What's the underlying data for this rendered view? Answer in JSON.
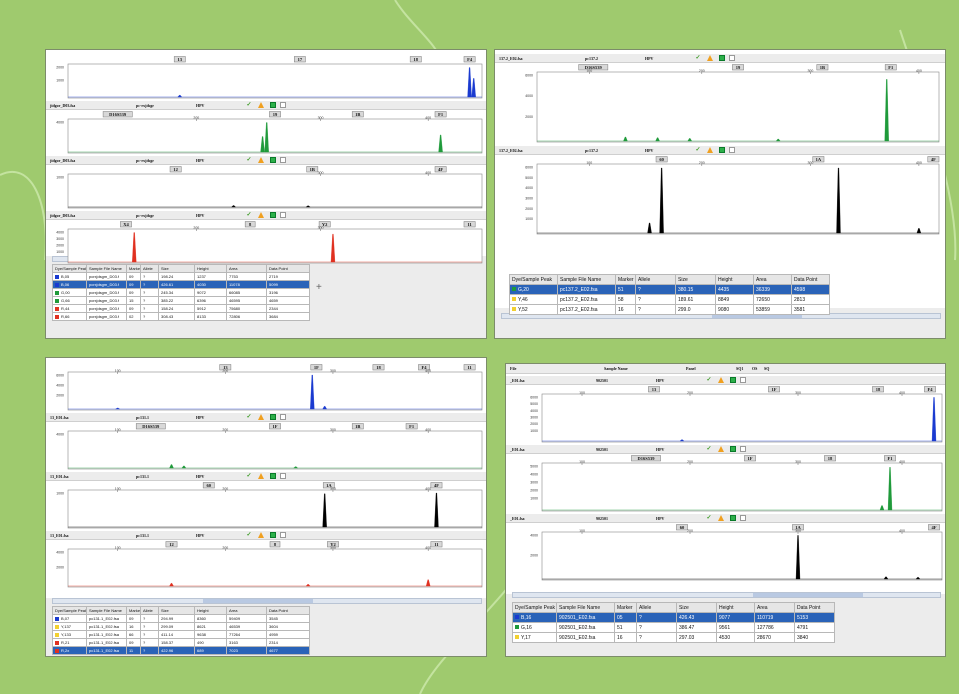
{
  "colors": {
    "background": "#9fca6e",
    "selected_row": "#2a63b8",
    "blue": "#1a3ad0",
    "green": "#1f9a3a",
    "black": "#000000",
    "red": "#e03020",
    "yellow": "#f2d030"
  },
  "panels": {
    "tl": {
      "tracks": [
        {
          "header": null,
          "bins": [
            [
              "13",
              0.27
            ],
            [
              "17",
              0.56
            ],
            [
              "18",
              0.84
            ],
            [
              "F4",
              0.97
            ]
          ],
          "ticks": [],
          "color": "#1a3ad0",
          "peaks": [
            [
              0.27,
              0.06
            ],
            [
              0.97,
              0.95
            ],
            [
              0.98,
              0.6
            ]
          ]
        },
        {
          "header": {
            "file": "jidgor_D03.fsa",
            "sample": "pc-rxjdsgr",
            "panel": "HPV"
          },
          "bins": [
            [
              "D16S539",
              0.12
            ],
            [
              "19",
              0.5
            ],
            [
              "1B",
              0.7
            ],
            [
              "F1",
              0.9
            ]
          ],
          "ticks": [
            [
              "200",
              0.31
            ],
            [
              "300",
              0.61
            ],
            [
              "400",
              0.87
            ]
          ],
          "color": "#1f9a3a",
          "peaks": [
            [
              0.48,
              0.95
            ],
            [
              0.47,
              0.5
            ],
            [
              0.9,
              0.55
            ]
          ]
        },
        {
          "header": {
            "file": "jidgor_D03.fsa",
            "sample": "pc-rxjdsgr",
            "panel": "HPV"
          },
          "bins": [
            [
              "12",
              0.26
            ],
            [
              "1B",
              0.59
            ],
            [
              "4F",
              0.9
            ]
          ],
          "ticks": [
            [
              "300",
              0.61
            ],
            [
              "400",
              0.87
            ]
          ],
          "color": "#000000",
          "peaks": [
            [
              0.4,
              0.05
            ],
            [
              0.58,
              0.04
            ]
          ]
        },
        {
          "header": {
            "file": "jidgor_D03.fsa",
            "sample": "pc-rxjdsgr",
            "panel": "HPV"
          },
          "bins": [
            [
              "X4",
              0.14
            ],
            [
              "8",
              0.44
            ],
            [
              "Y2",
              0.62
            ],
            [
              "11",
              0.97
            ]
          ],
          "ticks": [
            [
              "200",
              0.31
            ],
            [
              "300",
              0.61
            ]
          ],
          "color": "#e03020",
          "peaks": [
            [
              0.16,
              0.95
            ],
            [
              0.64,
              0.9
            ]
          ]
        }
      ],
      "yaxes": [
        [
          "2000",
          "1000"
        ],
        [
          "4000"
        ],
        [
          "1000"
        ],
        [
          "4000",
          "3000",
          "2000",
          "1000"
        ]
      ],
      "table": {
        "headers": [
          "Dye/Sample Peak",
          "Sample File Name",
          "Marker",
          "Allele",
          "Size",
          "Height",
          "Area",
          "Data Point"
        ],
        "rows": [
          {
            "dye": "#1a3ad0",
            "sel": false,
            "cells": [
              "B,05",
              "pcrxjdsgm_D03.f",
              "09",
              "?",
              "198.24",
              "1237",
              "7753",
              "2719"
            ]
          },
          {
            "dye": "#1a3ad0",
            "sel": true,
            "cells": [
              "B,06",
              "pcrxjdsgm_D03.f",
              "09",
              "?",
              "426.61",
              "4030",
              "11078",
              "5099"
            ]
          },
          {
            "dye": "#1f9a3a",
            "sel": false,
            "cells": [
              "G,00",
              "pcrxjdsgm_D03.f",
              "09",
              "?",
              "245.34",
              "9072",
              "66085",
              "3196"
            ]
          },
          {
            "dye": "#1f9a3a",
            "sel": false,
            "cells": [
              "G,66",
              "pcrxjdsgm_D03.f",
              "15",
              "?",
              "385.22",
              "6396",
              "46595",
              "4659"
            ]
          },
          {
            "dye": "#e03020",
            "sel": false,
            "cells": [
              "R,44",
              "pcrxjdsgm_D03.f",
              "09",
              "?",
              "158.24",
              "5912",
              "75680",
              "2344"
            ]
          },
          {
            "dye": "#e03020",
            "sel": false,
            "cells": [
              "R,66",
              "pcrxjdsgm_D03.f",
              "02",
              "?",
              "308.43",
              "8133",
              "72806",
              "3684"
            ]
          }
        ]
      }
    },
    "tr": {
      "tracks": [
        {
          "header": {
            "file": "137.2_E02.fsa",
            "sample": "pc137.2",
            "panel": "HPV"
          },
          "bins": [
            [
              "D16S539",
              0.14
            ],
            [
              "19",
              0.5
            ],
            [
              "1B",
              0.71
            ],
            [
              "F1",
              0.88
            ]
          ],
          "ticks": [
            [
              "100",
              0.13
            ],
            [
              "200",
              0.41
            ],
            [
              "300",
              0.68
            ],
            [
              "400",
              0.95
            ]
          ],
          "color": "#1f9a3a",
          "peaks": [
            [
              0.22,
              0.06
            ],
            [
              0.3,
              0.05
            ],
            [
              0.38,
              0.04
            ],
            [
              0.6,
              0.03
            ],
            [
              0.87,
              0.92
            ]
          ]
        },
        {
          "header": {
            "file": "137.2_E02.fsa",
            "sample": "pc137.2",
            "panel": "HPV"
          },
          "bins": [
            [
              "60",
              0.31
            ],
            [
              "1A",
              0.7
            ],
            [
              "4F",
              0.99
            ]
          ],
          "ticks": [
            [
              "100",
              0.13
            ],
            [
              "200",
              0.41
            ],
            [
              "300",
              0.68
            ],
            [
              "400",
              0.95
            ]
          ],
          "color": "#000000",
          "peaks": [
            [
              0.28,
              0.15
            ],
            [
              0.31,
              0.97
            ],
            [
              0.75,
              0.97
            ],
            [
              0.95,
              0.07
            ]
          ]
        }
      ],
      "yaxes": [
        [
          "6000",
          "4000",
          "2000"
        ],
        [
          "6000",
          "5000",
          "4000",
          "3000",
          "2000",
          "1000"
        ]
      ],
      "table": {
        "headers": [
          "Dye/Sample Peak",
          "Sample File Name",
          "Marker",
          "Allele",
          "Size",
          "Height",
          "Area",
          "Data Point"
        ],
        "rows": [
          {
            "dye": "#1f9a3a",
            "sel": true,
            "cells": [
              "G,20",
              "pc137.2_E02.fsa",
              "51",
              "?",
              "380.15",
              "4435",
              "36339",
              "4598"
            ]
          },
          {
            "dye": "#f2d030",
            "sel": false,
            "cells": [
              "Y,46",
              "pc137.2_E02.fsa",
              "58",
              "?",
              "189.61",
              "8849",
              "72650",
              "2813"
            ]
          },
          {
            "dye": "#f2d030",
            "sel": false,
            "cells": [
              "Y,52",
              "pc137.2_E02.fsa",
              "16",
              "?",
              "299.0",
              "9080",
              "53859",
              "3581"
            ]
          }
        ]
      }
    },
    "bl": {
      "tracks": [
        {
          "header": null,
          "bins": [
            [
              "13",
              0.38
            ],
            [
              "1F",
              0.6
            ],
            [
              "18",
              0.75
            ],
            [
              "F4",
              0.86
            ],
            [
              "11",
              0.97
            ]
          ],
          "ticks": [
            [
              "100",
              0.12
            ],
            [
              "200",
              0.38
            ],
            [
              "300",
              0.64
            ],
            [
              "400",
              0.87
            ]
          ],
          "color": "#1a3ad0",
          "peaks": [
            [
              0.12,
              0.03
            ],
            [
              0.59,
              0.97
            ],
            [
              0.62,
              0.08
            ]
          ]
        },
        {
          "header": {
            "file": "13_E01.fsa",
            "sample": "pc131.1",
            "panel": "HPV"
          },
          "bins": [
            [
              "D16S539",
              0.2
            ],
            [
              "1F",
              0.5
            ],
            [
              "1B",
              0.7
            ],
            [
              "F1",
              0.83
            ]
          ],
          "ticks": [
            [
              "100",
              0.12
            ],
            [
              "200",
              0.38
            ],
            [
              "300",
              0.64
            ],
            [
              "400",
              0.87
            ]
          ],
          "color": "#1f9a3a",
          "peaks": [
            [
              0.25,
              0.1
            ],
            [
              0.28,
              0.06
            ],
            [
              0.55,
              0.04
            ]
          ]
        },
        {
          "header": {
            "file": "13_E01.fsa",
            "sample": "pc131.1",
            "panel": "HPV"
          },
          "bins": [
            [
              "60",
              0.34
            ],
            [
              "1A",
              0.63
            ],
            [
              "4F",
              0.89
            ]
          ],
          "ticks": [
            [
              "100",
              0.12
            ],
            [
              "200",
              0.38
            ],
            [
              "300",
              0.64
            ],
            [
              "400",
              0.87
            ]
          ],
          "color": "#000000",
          "peaks": [
            [
              0.62,
              0.95
            ],
            [
              0.89,
              0.97
            ]
          ]
        },
        {
          "header": {
            "file": "13_E01.fsa",
            "sample": "pc131.1",
            "panel": "HPV"
          },
          "bins": [
            [
              "12",
              0.25
            ],
            [
              "8",
              0.5
            ],
            [
              "Y2",
              0.64
            ],
            [
              "11",
              0.89
            ]
          ],
          "ticks": [
            [
              "100",
              0.12
            ],
            [
              "200",
              0.38
            ],
            [
              "300",
              0.64
            ],
            [
              "400",
              0.87
            ]
          ],
          "color": "#e03020",
          "peaks": [
            [
              0.25,
              0.08
            ],
            [
              0.58,
              0.05
            ],
            [
              0.87,
              0.18
            ]
          ]
        }
      ],
      "yaxes": [
        [
          "6000",
          "4000",
          "2000"
        ],
        [
          "4000"
        ],
        [
          "1000"
        ],
        [
          "4000",
          "2000"
        ]
      ],
      "table": {
        "headers": [
          "Dye/Sample Peak",
          "Sample File Name",
          "Marker",
          "Allele",
          "Size",
          "Height",
          "Area",
          "Data Point"
        ],
        "rows": [
          {
            "dye": "#1a3ad0",
            "sel": false,
            "cells": [
              "B,07",
              "pc131.1_E02.fsa",
              "09",
              "?",
              "294.99",
              "8360",
              "59409",
              "3545"
            ]
          },
          {
            "dye": "#f2d030",
            "sel": false,
            "cells": [
              "Y,137",
              "pc131.1_E02.fsa",
              "16",
              "?",
              "299.09",
              "8621",
              "46539",
              "3604"
            ]
          },
          {
            "dye": "#f2d030",
            "sel": false,
            "cells": [
              "Y,133",
              "pc131.1_E02.fsa",
              "66",
              "?",
              "411.14",
              "9638",
              "77264",
              "4959"
            ]
          },
          {
            "dye": "#e03020",
            "sel": false,
            "cells": [
              "R,21",
              "pc131.1_E02.fsa",
              "09",
              "?",
              "158.37",
              "490",
              "3163",
              "2314"
            ]
          },
          {
            "dye": "#e03020",
            "sel": true,
            "cells": [
              "R,2x",
              "pc131.1_E02.fsa",
              "11",
              "?",
              "422.96",
              "689",
              "7023",
              "4677"
            ]
          }
        ]
      }
    },
    "br": {
      "top_header": {
        "file": "File",
        "sample": "Sample Name",
        "panel": "Panel",
        "sq1": "SQ1",
        "os": "OS",
        "sq": "SQ"
      },
      "tracks": [
        {
          "header": {
            "file": "_E01.fsa",
            "sample": "902501",
            "panel": "HPV"
          },
          "bins": [
            [
              "13",
              0.28
            ],
            [
              "1F",
              0.58
            ],
            [
              "18",
              0.84
            ],
            [
              "F4",
              0.97
            ]
          ],
          "ticks": [
            [
              "100",
              0.1
            ],
            [
              "200",
              0.37
            ],
            [
              "300",
              0.64
            ],
            [
              "400",
              0.9
            ]
          ],
          "color": "#1a3ad0",
          "peaks": [
            [
              0.98,
              0.97
            ],
            [
              0.35,
              0.03
            ]
          ]
        },
        {
          "header": {
            "file": "_E01.fsa",
            "sample": "902501",
            "panel": "HPV"
          },
          "bins": [
            [
              "D16S539",
              0.26
            ],
            [
              "1F",
              0.52
            ],
            [
              "18",
              0.72
            ],
            [
              "F1",
              0.87
            ]
          ],
          "ticks": [
            [
              "100",
              0.1
            ],
            [
              "200",
              0.37
            ],
            [
              "300",
              0.64
            ],
            [
              "400",
              0.9
            ]
          ],
          "color": "#1f9a3a",
          "peaks": [
            [
              0.87,
              0.95
            ],
            [
              0.85,
              0.1
            ]
          ]
        },
        {
          "header": {
            "file": "_E01.fsa",
            "sample": "902501",
            "panel": "HPV"
          },
          "bins": [
            [
              "60",
              0.35
            ],
            [
              "1A",
              0.64
            ],
            [
              "4F",
              0.98
            ]
          ],
          "ticks": [
            [
              "100",
              0.1
            ],
            [
              "200",
              0.37
            ],
            [
              "300",
              0.64
            ],
            [
              "400",
              0.9
            ]
          ],
          "color": "#000000",
          "peaks": [
            [
              0.64,
              0.97
            ],
            [
              0.86,
              0.05
            ],
            [
              0.94,
              0.04
            ]
          ]
        }
      ],
      "yaxes": [
        [
          "6000",
          "5000",
          "4000",
          "3000",
          "2000",
          "1000"
        ],
        [
          "5000",
          "4000",
          "3000",
          "2000",
          "1000"
        ],
        [
          "4000",
          "2000"
        ]
      ],
      "table": {
        "headers": [
          "Dye/Sample Peak",
          "Sample File Name",
          "Marker",
          "Allele",
          "Size",
          "Height",
          "Area",
          "Data Point"
        ],
        "rows": [
          {
            "dye": "#1a3ad0",
            "sel": true,
            "cells": [
              "B,16",
              "902501_E02.fsa",
              "05",
              "?",
              "426.43",
              "9077",
              "110719",
              "5153"
            ]
          },
          {
            "dye": "#1f9a3a",
            "sel": false,
            "cells": [
              "G,16",
              "902501_E02.fsa",
              "51",
              "?",
              "386.47",
              "9561",
              "127786",
              "4791"
            ]
          },
          {
            "dye": "#f2d030",
            "sel": false,
            "cells": [
              "Y,17",
              "902501_E02.fsa",
              "16",
              "?",
              "297.03",
              "4530",
              "28670",
              "3840"
            ]
          }
        ]
      }
    }
  }
}
